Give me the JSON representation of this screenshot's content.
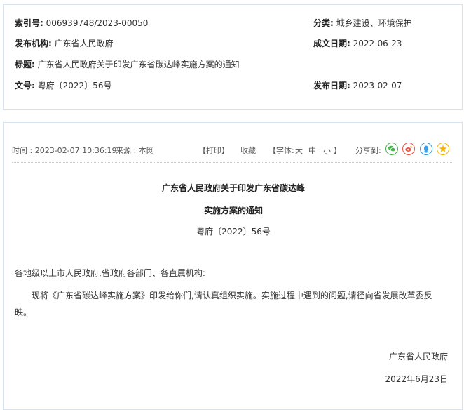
{
  "meta": {
    "index_label": "索引号:",
    "index_value": "006939748/2023-00050",
    "category_label": "分类:",
    "category_value": "城乡建设、环境保护",
    "issuer_label": "发布机构:",
    "issuer_value": "广东省人民政府",
    "written_date_label": "成文日期:",
    "written_date_value": "2022-06-23",
    "title_label": "标题:",
    "title_value": "广东省人民政府关于印发广东省碳达峰实施方案的通知",
    "docno_label": "文号:",
    "docno_value": "粤府〔2022〕56号",
    "publish_date_label": "发布日期:",
    "publish_date_value": "2023-02-07"
  },
  "toolbar": {
    "time_text": "时间 : 2023-02-07 10:36:19",
    "source_text": "来源 : 本网",
    "print_text": "【打印】",
    "favorite_text": "收藏",
    "font_prefix": "【字体:",
    "font_large": "大",
    "font_medium": "中",
    "font_small": "小",
    "font_suffix": "】",
    "share_text": "分享到:",
    "share_colors": {
      "wechat": "#4caf50",
      "weibo": "#e9574a",
      "qq": "#3a9de6",
      "qzone": "#f4b400"
    }
  },
  "article": {
    "title_line1": "广东省人民政府关于印发广东省碳达峰",
    "title_line2": "实施方案的通知",
    "docno": "粤府〔2022〕56号",
    "salutation": "各地级以上市人民政府,省政府各部门、各直属机构:",
    "paragraph1_line1": "现将《广东省碳达峰实施方案》印发给你们,请认真组织实施。实施过程中遇到的问题,请径向省发展改革委反",
    "paragraph1_line2": "映。",
    "signature": "广东省人民政府",
    "date": "2022年6月23日"
  }
}
